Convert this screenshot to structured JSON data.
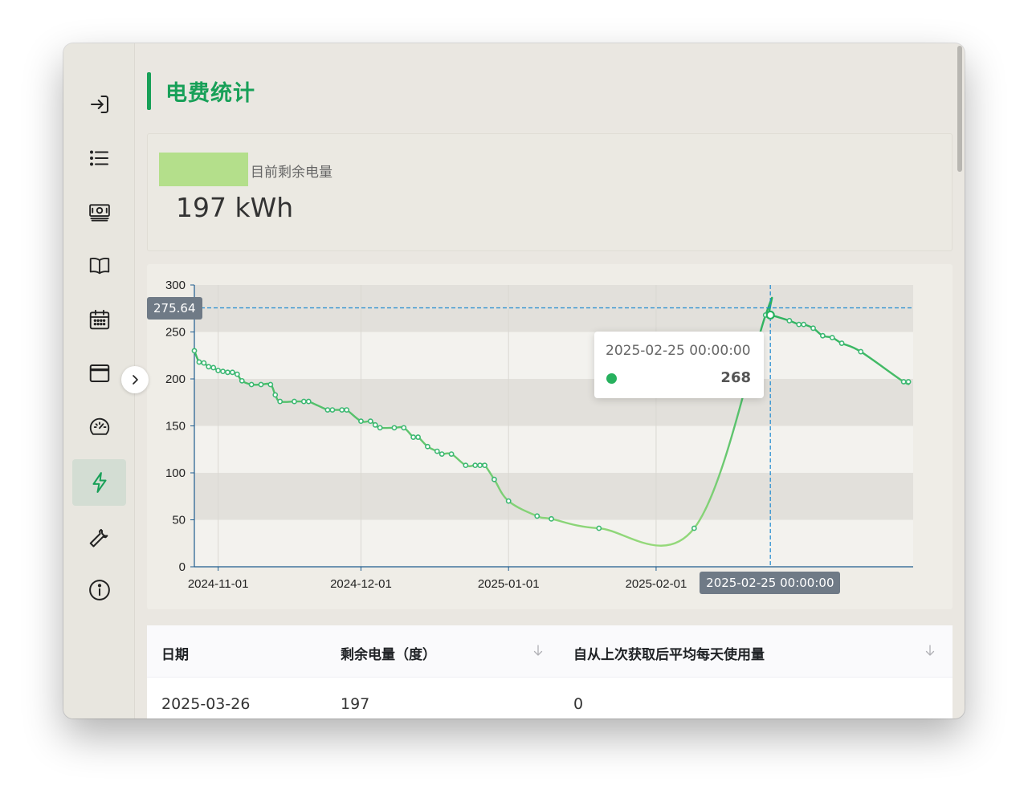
{
  "app": {
    "title": "电费统计"
  },
  "sidebar": {
    "items": [
      {
        "icon": "login-icon"
      },
      {
        "icon": "list-icon"
      },
      {
        "icon": "money-icon"
      },
      {
        "icon": "book-icon"
      },
      {
        "icon": "calendar-icon"
      },
      {
        "icon": "window-icon"
      },
      {
        "icon": "dashboard-icon"
      },
      {
        "icon": "lightning-icon",
        "active": true
      },
      {
        "icon": "wrench-icon"
      },
      {
        "icon": "info-icon"
      }
    ],
    "accent": "#18a058"
  },
  "stat": {
    "label": "目前剩余电量",
    "value": "197 kWh",
    "badge_color": "#b4df8b"
  },
  "chart_data": {
    "type": "line",
    "y_range": [
      0,
      300
    ],
    "y_ticks": [
      "0",
      "50",
      "100",
      "150",
      "200",
      "250",
      "300"
    ],
    "x_ticks": [
      "2024-11-01",
      "2024-12-01",
      "2025-01-01",
      "2025-02-01"
    ],
    "x_range": [
      "2024-10-27",
      "2025-03-27"
    ],
    "series": [
      {
        "x": [
          "2024-10-27",
          "2024-10-28",
          "2024-10-29",
          "2024-10-30",
          "2024-10-31",
          "2024-11-01",
          "2024-11-02",
          "2024-11-03",
          "2024-11-04",
          "2024-11-05",
          "2024-11-06",
          "2024-11-08",
          "2024-11-10",
          "2024-11-12",
          "2024-11-13",
          "2024-11-14",
          "2024-11-17",
          "2024-11-19",
          "2024-11-20",
          "2024-11-24",
          "2024-11-25",
          "2024-11-27",
          "2024-11-28",
          "2024-12-01",
          "2024-12-03",
          "2024-12-04",
          "2024-12-05",
          "2024-12-08",
          "2024-12-10",
          "2024-12-12",
          "2024-12-13",
          "2024-12-15",
          "2024-12-17",
          "2024-12-18",
          "2024-12-20",
          "2024-12-23",
          "2024-12-25",
          "2024-12-26",
          "2024-12-27",
          "2024-12-29",
          "2025-01-01",
          "2025-01-07",
          "2025-01-10",
          "2025-01-20",
          "2025-02-09",
          "2025-02-24",
          "2025-02-25",
          "2025-03-01",
          "2025-03-03",
          "2025-03-04",
          "2025-03-06",
          "2025-03-08",
          "2025-03-10",
          "2025-03-12",
          "2025-03-16",
          "2025-03-25",
          "2025-03-26"
        ],
        "y": [
          230,
          218,
          217,
          213,
          212,
          209,
          208,
          207,
          207,
          205,
          198,
          194,
          194,
          194,
          183,
          176,
          176,
          176,
          176,
          167,
          167,
          167,
          167,
          155,
          155,
          151,
          148,
          148,
          148,
          138,
          138,
          128,
          123,
          120,
          120,
          108,
          108,
          108,
          108,
          93,
          70,
          54,
          51,
          41,
          41,
          268,
          268,
          262,
          258,
          258,
          254,
          246,
          244,
          238,
          229,
          197,
          197
        ]
      }
    ],
    "markers": {
      "y_line": "275.64",
      "x_line": "2025-02-25 00:00:00"
    },
    "tooltip": {
      "date": "2025-02-25 00:00:00",
      "value": "268"
    },
    "colors": {
      "line_start": "#27b15e",
      "line_mid": "#95d97a",
      "line_end": "#27b15e",
      "marker": "#1f8ad0"
    }
  },
  "table": {
    "columns": [
      "日期",
      "剩余电量（度）",
      "自从上次获取后平均每天使用量"
    ],
    "rows": [
      [
        "2025-03-26",
        "197",
        "0"
      ]
    ]
  }
}
